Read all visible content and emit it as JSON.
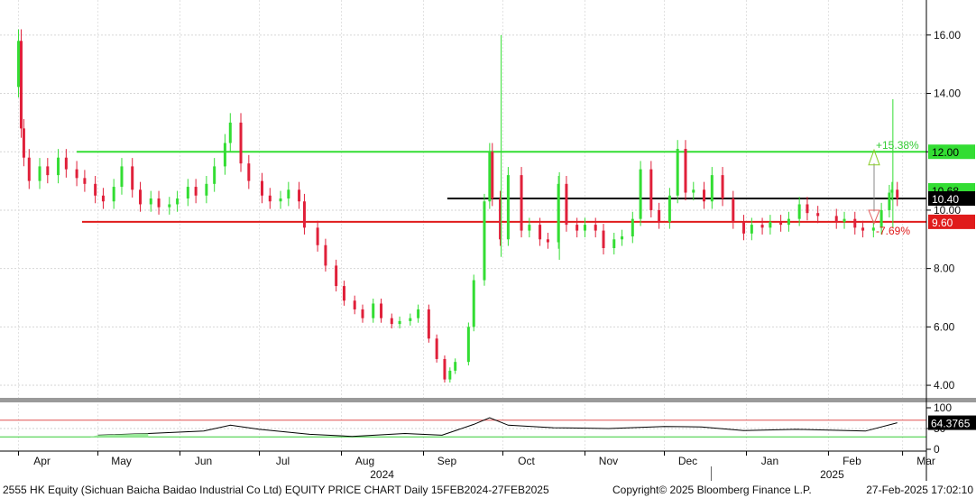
{
  "chart_data": {
    "type": "candlestick",
    "ticker_line": "2555 HK Equity (Sichuan Baicha Baidao Industrial Co Ltd) EQUITY PRICE CHART",
    "period": "Daily 15FEB2024-27FEB2025",
    "copyright": "Copyright© 2025 Bloomberg Finance L.P.",
    "timestamp": "27-Feb-2025 17:02:10",
    "x_range": [
      "2024-03-25",
      "2025-03-10"
    ],
    "y_range": [
      3.6,
      17.2
    ],
    "y_ticks": [
      "4.00",
      "6.00",
      "8.00",
      "10.00",
      "12.00",
      "14.00",
      "16.00"
    ],
    "month_labels": [
      {
        "label": "Apr",
        "date": "2024-04-01"
      },
      {
        "label": "May",
        "date": "2024-05-01"
      },
      {
        "label": "Jun",
        "date": "2024-06-01"
      },
      {
        "label": "Jul",
        "date": "2024-07-01"
      },
      {
        "label": "Aug",
        "date": "2024-08-01"
      },
      {
        "label": "Sep",
        "date": "2024-09-01"
      },
      {
        "label": "Oct",
        "date": "2024-10-01"
      },
      {
        "label": "Nov",
        "date": "2024-11-01"
      },
      {
        "label": "Dec",
        "date": "2024-12-01"
      },
      {
        "label": "Jan",
        "date": "2025-01-01"
      },
      {
        "label": "Feb",
        "date": "2025-02-01"
      },
      {
        "label": "Mar",
        "date": "2025-03-01"
      }
    ],
    "year_labels": [
      {
        "label": "2024",
        "date": "2024-08-15"
      },
      {
        "label": "2025",
        "date": "2025-02-01"
      }
    ],
    "reference_lines": [
      {
        "value": 12.0,
        "label": "12.00",
        "color": "#33dd33",
        "from": "2024-04-23"
      },
      {
        "value": 10.4,
        "label": "10.40",
        "color": "#000000",
        "from": "2024-09-10"
      },
      {
        "value": 9.6,
        "label": "9.60",
        "color": "#e01b1b",
        "from": "2024-04-25"
      }
    ],
    "last_price_badge": "10.68",
    "pct_up": "+15.38%",
    "pct_down": "-7.69%",
    "rsi_value": "64.3765",
    "rsi_ticks": [
      "100",
      "50",
      "0"
    ],
    "rsi_levels": [
      70,
      30
    ],
    "colors": {
      "up": "#33dd33",
      "down": "#e0203a",
      "wick_up": "#33dd33",
      "wick_down": "#e0203a"
    },
    "price_points": [
      [
        "2024-04-01",
        15.8
      ],
      [
        "2024-04-02",
        12.8
      ],
      [
        "2024-04-03",
        11.8
      ],
      [
        "2024-04-05",
        11.0
      ],
      [
        "2024-04-09",
        11.5
      ],
      [
        "2024-04-12",
        11.2
      ],
      [
        "2024-04-16",
        11.8
      ],
      [
        "2024-04-19",
        11.4
      ],
      [
        "2024-04-23",
        11.1
      ],
      [
        "2024-04-26",
        10.9
      ],
      [
        "2024-04-30",
        10.5
      ],
      [
        "2024-05-03",
        10.3
      ],
      [
        "2024-05-07",
        10.8
      ],
      [
        "2024-05-10",
        11.5
      ],
      [
        "2024-05-14",
        10.7
      ],
      [
        "2024-05-17",
        10.2
      ],
      [
        "2024-05-21",
        10.4
      ],
      [
        "2024-05-24",
        10.1
      ],
      [
        "2024-05-28",
        10.2
      ],
      [
        "2024-05-31",
        10.4
      ],
      [
        "2024-06-04",
        10.8
      ],
      [
        "2024-06-07",
        10.5
      ],
      [
        "2024-06-11",
        10.9
      ],
      [
        "2024-06-14",
        11.5
      ],
      [
        "2024-06-18",
        12.3
      ],
      [
        "2024-06-20",
        13.0
      ],
      [
        "2024-06-24",
        11.6
      ],
      [
        "2024-06-27",
        11.0
      ],
      [
        "2024-07-02",
        10.5
      ],
      [
        "2024-07-05",
        10.3
      ],
      [
        "2024-07-09",
        10.4
      ],
      [
        "2024-07-12",
        10.7
      ],
      [
        "2024-07-16",
        10.3
      ],
      [
        "2024-07-18",
        9.4
      ],
      [
        "2024-07-23",
        8.8
      ],
      [
        "2024-07-26",
        8.1
      ],
      [
        "2024-07-30",
        7.4
      ],
      [
        "2024-08-02",
        6.9
      ],
      [
        "2024-08-06",
        6.6
      ],
      [
        "2024-08-09",
        6.3
      ],
      [
        "2024-08-13",
        6.8
      ],
      [
        "2024-08-16",
        6.3
      ],
      [
        "2024-08-20",
        6.1
      ],
      [
        "2024-08-23",
        6.2
      ],
      [
        "2024-08-27",
        6.3
      ],
      [
        "2024-08-30",
        6.6
      ],
      [
        "2024-09-03",
        5.6
      ],
      [
        "2024-09-06",
        4.9
      ],
      [
        "2024-09-09",
        4.2
      ],
      [
        "2024-09-11",
        4.5
      ],
      [
        "2024-09-13",
        4.8
      ],
      [
        "2024-09-18",
        6.0
      ],
      [
        "2024-09-20",
        7.6
      ],
      [
        "2024-09-24",
        10.3
      ],
      [
        "2024-09-26",
        12.0
      ],
      [
        "2024-09-27",
        10.4
      ],
      [
        "2024-09-30",
        9.0
      ],
      [
        "2024-10-03",
        11.2
      ],
      [
        "2024-10-08",
        9.3
      ],
      [
        "2024-10-11",
        9.5
      ],
      [
        "2024-10-15",
        9.0
      ],
      [
        "2024-10-18",
        8.9
      ],
      [
        "2024-10-22",
        10.9
      ],
      [
        "2024-10-25",
        9.5
      ],
      [
        "2024-10-29",
        9.3
      ],
      [
        "2024-11-01",
        9.5
      ],
      [
        "2024-11-05",
        9.3
      ],
      [
        "2024-11-08",
        8.7
      ],
      [
        "2024-11-12",
        9.0
      ],
      [
        "2024-11-15",
        9.1
      ],
      [
        "2024-11-19",
        9.7
      ],
      [
        "2024-11-22",
        11.4
      ],
      [
        "2024-11-26",
        10.0
      ],
      [
        "2024-11-29",
        9.6
      ],
      [
        "2024-12-03",
        10.5
      ],
      [
        "2024-12-06",
        12.1
      ],
      [
        "2024-12-09",
        10.6
      ],
      [
        "2024-12-12",
        10.7
      ],
      [
        "2024-12-16",
        10.3
      ],
      [
        "2024-12-19",
        11.2
      ],
      [
        "2024-12-23",
        10.4
      ],
      [
        "2024-12-27",
        9.6
      ],
      [
        "2024-12-31",
        9.2
      ],
      [
        "2025-01-03",
        9.5
      ],
      [
        "2025-01-07",
        9.4
      ],
      [
        "2025-01-10",
        9.6
      ],
      [
        "2025-01-14",
        9.5
      ],
      [
        "2025-01-17",
        9.7
      ],
      [
        "2025-01-21",
        10.2
      ],
      [
        "2025-01-24",
        9.9
      ],
      [
        "2025-01-28",
        9.8
      ],
      [
        "2025-02-04",
        9.6
      ],
      [
        "2025-02-07",
        9.7
      ],
      [
        "2025-02-11",
        9.4
      ],
      [
        "2025-02-14",
        9.3
      ],
      [
        "2025-02-18",
        9.4
      ],
      [
        "2025-02-21",
        10.0
      ],
      [
        "2025-02-24",
        10.6
      ],
      [
        "2025-02-25",
        10.7
      ],
      [
        "2025-02-27",
        10.4
      ]
    ],
    "wick_spikes": [
      {
        "date": "2024-09-30",
        "high": 16.0,
        "low": 8.4
      },
      {
        "date": "2024-10-22",
        "high": 11.3,
        "low": 8.3
      },
      {
        "date": "2025-02-25",
        "high": 13.8,
        "low": 9.4
      }
    ],
    "rsi_points": [
      [
        "2024-05-01",
        34
      ],
      [
        "2024-05-20",
        38
      ],
      [
        "2024-06-10",
        44
      ],
      [
        "2024-06-20",
        58
      ],
      [
        "2024-07-01",
        48
      ],
      [
        "2024-07-20",
        36
      ],
      [
        "2024-08-05",
        31
      ],
      [
        "2024-08-25",
        38
      ],
      [
        "2024-09-08",
        34
      ],
      [
        "2024-09-20",
        60
      ],
      [
        "2024-09-26",
        76
      ],
      [
        "2024-10-03",
        58
      ],
      [
        "2024-10-20",
        52
      ],
      [
        "2024-11-10",
        50
      ],
      [
        "2024-12-01",
        55
      ],
      [
        "2024-12-15",
        54
      ],
      [
        "2024-12-31",
        45
      ],
      [
        "2025-01-20",
        48
      ],
      [
        "2025-02-15",
        44
      ],
      [
        "2025-02-27",
        64
      ]
    ]
  }
}
